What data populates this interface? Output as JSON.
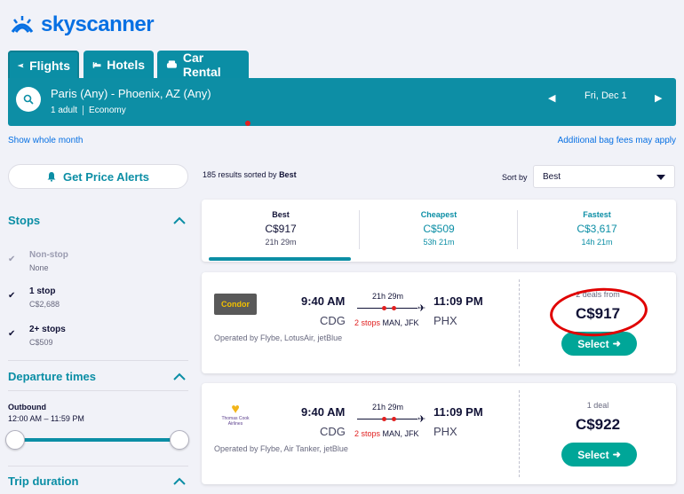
{
  "brand": {
    "name": "skyscanner",
    "color": "#0770e3"
  },
  "tabs": [
    {
      "label": "Flights",
      "icon": "plane-icon"
    },
    {
      "label": "Hotels",
      "icon": "bed-icon"
    },
    {
      "label": "Car Rental",
      "icon": "car-icon"
    }
  ],
  "search": {
    "route": "Paris (Any) - Phoenix, AZ (Any)",
    "passengers": "1 adult",
    "cabin": "Economy",
    "date": "Fri, Dec 1",
    "prev": "◀",
    "next": "▶"
  },
  "links": {
    "show_month": "Show whole month",
    "bag_fees": "Additional bag fees may apply"
  },
  "sidebar": {
    "price_alerts": "Get Price Alerts",
    "stops_heading": "Stops",
    "stops": [
      {
        "label": "Non-stop",
        "sub": "None",
        "checked": true,
        "disabled": true
      },
      {
        "label": "1 stop",
        "sub": "C$2,688",
        "checked": true,
        "disabled": false
      },
      {
        "label": "2+ stops",
        "sub": "C$509",
        "checked": true,
        "disabled": false
      }
    ],
    "departure_heading": "Departure times",
    "outbound_label": "Outbound",
    "outbound_range": "12:00 AM – 11:59 PM",
    "trip_heading": "Trip duration"
  },
  "results": {
    "count_text": "185 results sorted by",
    "sorted_by": "Best",
    "sort_label": "Sort by",
    "sort_value": "Best"
  },
  "sort_tabs": [
    {
      "label": "Best",
      "price": "C$917",
      "duration": "21h 29m",
      "active": true
    },
    {
      "label": "Cheapest",
      "price": "C$509",
      "duration": "53h 21m",
      "active": false
    },
    {
      "label": "Fastest",
      "price": "C$3,617",
      "duration": "14h 21m",
      "active": false
    }
  ],
  "flights": [
    {
      "airline": "Condor",
      "dep_time": "9:40 AM",
      "dep_code": "CDG",
      "duration": "21h 29m",
      "stops": "2 stops",
      "via": "MAN, JFK",
      "arr_time": "11:09 PM",
      "arr_code": "PHX",
      "operated": "Operated by Flybe, LotusAir, jetBlue",
      "deals": "2 deals from",
      "price": "C$917",
      "select": "Select"
    },
    {
      "airline": "Thomas Cook Airlines",
      "dep_time": "9:40 AM",
      "dep_code": "CDG",
      "duration": "21h 29m",
      "stops": "2 stops",
      "via": "MAN, JFK",
      "arr_time": "11:09 PM",
      "arr_code": "PHX",
      "operated": "Operated by Flybe, Air Tanker, jetBlue",
      "deals": "1 deal",
      "price": "C$922",
      "select": "Select"
    }
  ],
  "colors": {
    "teal": "#0b8ea5",
    "green": "#00a698",
    "red_highlight": "#e00000"
  }
}
